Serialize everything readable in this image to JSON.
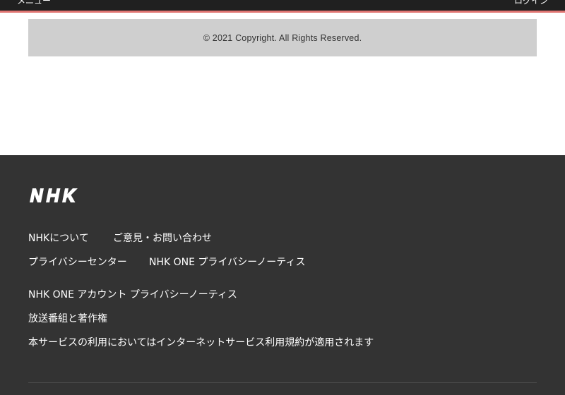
{
  "header": {
    "menu_label": "メニュー",
    "login_label": "ログイン"
  },
  "copyright": {
    "text": "© 2021 Copyright. All Rights Reserved."
  },
  "footer": {
    "logo_text": "NHK",
    "links": {
      "about": "NHKについて",
      "feedback": "ご意見・お問い合わせ",
      "privacy_center": "プライバシーセンター",
      "one_privacy": "NHK ONE プライバシーノーティス",
      "account_privacy": "NHK ONE アカウント プライバシーノーティス",
      "copyright_programs": "放送番組と著作権",
      "terms": "本サービスの利用においてはインターネットサービス利用規約が適用されます"
    }
  },
  "colors": {
    "header_bg": "#202020",
    "header_accent": "#e07572",
    "copyright_bg": "#cfcfcf",
    "footer_bg": "#333333"
  }
}
